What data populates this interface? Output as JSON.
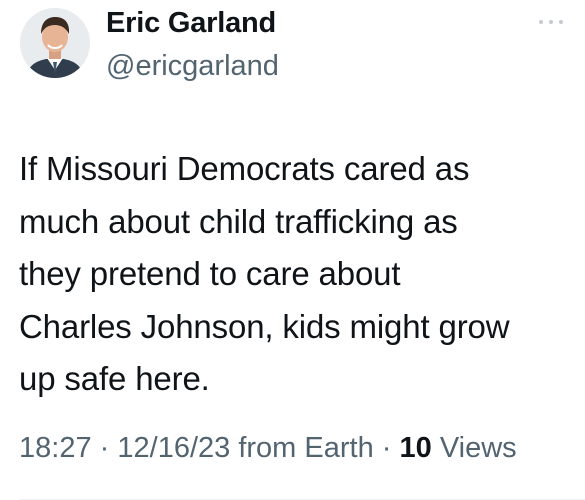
{
  "author": {
    "name": "Eric Garland",
    "handle": "@ericgarland",
    "avatar_icon": "profile-photo"
  },
  "more_icon": "more-horizontal-icon",
  "tweet": {
    "text": "If Missouri Democrats cared as\nmuch about child trafficking as\nthey pretend to care about\nCharles Johnson, kids might grow\nup safe here."
  },
  "meta": {
    "time": "18:27",
    "separator": "·",
    "date": "12/16/23",
    "source": "from Earth",
    "views_count": "10",
    "views_label": "Views"
  },
  "colors": {
    "text": "#0f1419",
    "secondary": "#536471",
    "background": "#ffffff"
  }
}
